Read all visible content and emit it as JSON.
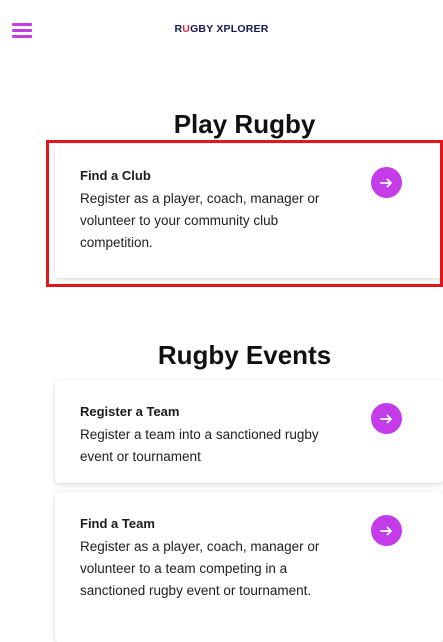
{
  "header": {
    "brand_prefix": "R",
    "brand_u": "U",
    "brand_suffix": "GBY XPLORER",
    "menu_icon": "hamburger-menu-icon"
  },
  "sections": [
    {
      "title": "Play Rugby",
      "cards": [
        {
          "title": "Find a Club",
          "description": "Register as a player, coach, manager or volunteer to your community club competition.",
          "icon": "arrow-right-icon"
        }
      ]
    },
    {
      "title": "Rugby Events",
      "cards": [
        {
          "title": "Register a Team",
          "description": "Register a team into a sanctioned rugby event or tournament",
          "icon": "arrow-right-icon"
        },
        {
          "title": "Find a Team",
          "description": "Register as a player, coach, manager or volunteer to a team competing in a sanctioned rugby event or tournament.",
          "icon": "arrow-right-icon"
        }
      ]
    }
  ],
  "colors": {
    "accent": "#c43be8",
    "brand_navy": "#151a52",
    "brand_red": "#e2263f",
    "highlight_border": "#e3161c"
  }
}
